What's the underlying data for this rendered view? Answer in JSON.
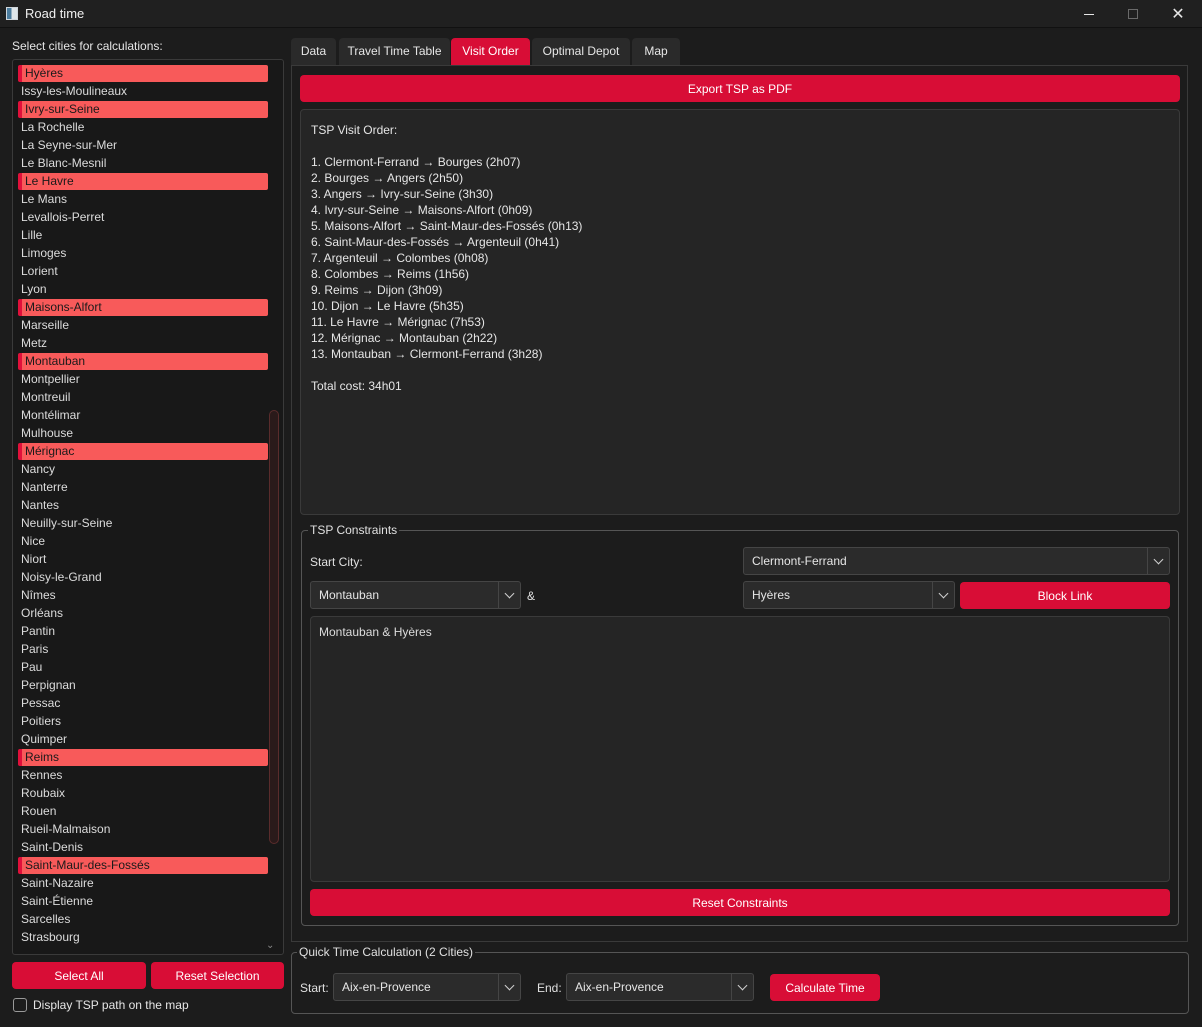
{
  "window": {
    "title": "Road time"
  },
  "left": {
    "label": "Select cities for calculations:",
    "cities": [
      {
        "name": "Hyères",
        "selected": true
      },
      {
        "name": "Issy-les-Moulineaux",
        "selected": false
      },
      {
        "name": "Ivry-sur-Seine",
        "selected": true
      },
      {
        "name": "La Rochelle",
        "selected": false
      },
      {
        "name": "La Seyne-sur-Mer",
        "selected": false
      },
      {
        "name": "Le Blanc-Mesnil",
        "selected": false
      },
      {
        "name": "Le Havre",
        "selected": true
      },
      {
        "name": "Le Mans",
        "selected": false
      },
      {
        "name": "Levallois-Perret",
        "selected": false
      },
      {
        "name": "Lille",
        "selected": false
      },
      {
        "name": "Limoges",
        "selected": false
      },
      {
        "name": "Lorient",
        "selected": false
      },
      {
        "name": "Lyon",
        "selected": false
      },
      {
        "name": "Maisons-Alfort",
        "selected": true
      },
      {
        "name": "Marseille",
        "selected": false
      },
      {
        "name": "Metz",
        "selected": false
      },
      {
        "name": "Montauban",
        "selected": true
      },
      {
        "name": "Montpellier",
        "selected": false
      },
      {
        "name": "Montreuil",
        "selected": false
      },
      {
        "name": "Montélimar",
        "selected": false
      },
      {
        "name": "Mulhouse",
        "selected": false
      },
      {
        "name": "Mérignac",
        "selected": true
      },
      {
        "name": "Nancy",
        "selected": false
      },
      {
        "name": "Nanterre",
        "selected": false
      },
      {
        "name": "Nantes",
        "selected": false
      },
      {
        "name": "Neuilly-sur-Seine",
        "selected": false
      },
      {
        "name": "Nice",
        "selected": false
      },
      {
        "name": "Niort",
        "selected": false
      },
      {
        "name": "Noisy-le-Grand",
        "selected": false
      },
      {
        "name": "Nîmes",
        "selected": false
      },
      {
        "name": "Orléans",
        "selected": false
      },
      {
        "name": "Pantin",
        "selected": false
      },
      {
        "name": "Paris",
        "selected": false
      },
      {
        "name": "Pau",
        "selected": false
      },
      {
        "name": "Perpignan",
        "selected": false
      },
      {
        "name": "Pessac",
        "selected": false
      },
      {
        "name": "Poitiers",
        "selected": false
      },
      {
        "name": "Quimper",
        "selected": false
      },
      {
        "name": "Reims",
        "selected": true
      },
      {
        "name": "Rennes",
        "selected": false
      },
      {
        "name": "Roubaix",
        "selected": false
      },
      {
        "name": "Rouen",
        "selected": false
      },
      {
        "name": "Rueil-Malmaison",
        "selected": false
      },
      {
        "name": "Saint-Denis",
        "selected": false
      },
      {
        "name": "Saint-Maur-des-Fossés",
        "selected": true
      },
      {
        "name": "Saint-Nazaire",
        "selected": false
      },
      {
        "name": "Saint-Étienne",
        "selected": false
      },
      {
        "name": "Sarcelles",
        "selected": false
      },
      {
        "name": "Strasbourg",
        "selected": false
      }
    ],
    "select_all": "Select All",
    "reset_selection": "Reset Selection",
    "display_tsp_label": "Display TSP path on the map"
  },
  "tabs": [
    "Data",
    "Travel Time Table",
    "Visit Order",
    "Optimal Depot",
    "Map"
  ],
  "active_tab": "Visit Order",
  "visit_order": {
    "export_button": "Export TSP as PDF",
    "heading": "TSP Visit Order:",
    "steps": [
      "1. Clermont-Ferrand → Bourges (2h07)",
      "2. Bourges → Angers (2h50)",
      "3. Angers → Ivry-sur-Seine (3h30)",
      "4. Ivry-sur-Seine → Maisons-Alfort (0h09)",
      "5. Maisons-Alfort → Saint-Maur-des-Fossés (0h13)",
      "6. Saint-Maur-des-Fossés → Argenteuil (0h41)",
      "7. Argenteuil → Colombes (0h08)",
      "8. Colombes → Reims (1h56)",
      "9. Reims → Dijon (3h09)",
      "10. Dijon → Le Havre (5h35)",
      "11. Le Havre → Mérignac (7h53)",
      "12. Mérignac → Montauban (2h22)",
      "13. Montauban → Clermont-Ferrand (3h28)"
    ],
    "total": "Total cost: 34h01"
  },
  "constraints": {
    "title": "TSP Constraints",
    "start_city_label": "Start City:",
    "start_city_value": "Clermont-Ferrand",
    "city_a": "Montauban",
    "ampersand": "&",
    "city_b": "Hyères",
    "block_link": "Block Link",
    "blocked_links": [
      "Montauban & Hyères"
    ],
    "reset_button": "Reset Constraints"
  },
  "quick": {
    "title": "Quick Time Calculation (2 Cities)",
    "start_label": "Start:",
    "start_value": "Aix-en-Provence",
    "end_label": "End:",
    "end_value": "Aix-en-Provence",
    "calculate": "Calculate Time"
  },
  "colors": {
    "accent": "#d80d36",
    "selection": "#f85a5a",
    "background": "#1c1c1c"
  }
}
